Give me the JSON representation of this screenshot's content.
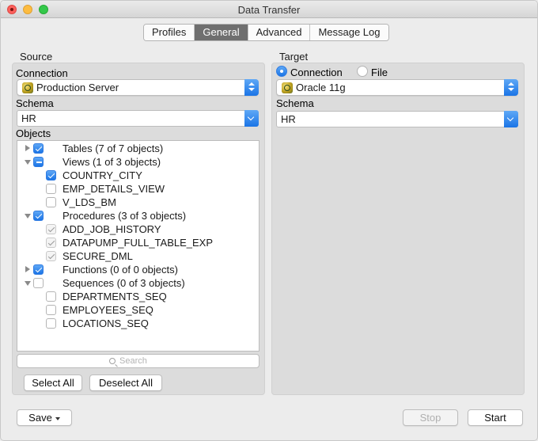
{
  "window": {
    "title": "Data Transfer"
  },
  "tabs": [
    {
      "label": "Profiles",
      "active": false
    },
    {
      "label": "General",
      "active": true
    },
    {
      "label": "Advanced",
      "active": false
    },
    {
      "label": "Message Log",
      "active": false
    }
  ],
  "source": {
    "section_label": "Source",
    "connection_label": "Connection",
    "connection_value": "Production Server",
    "schema_label": "Schema",
    "schema_value": "HR",
    "objects_label": "Objects",
    "tree": [
      {
        "label": "Tables (7 of 7 objects)",
        "level": 0,
        "expander": "collapsed",
        "check": "on"
      },
      {
        "label": "Views (1 of 3 objects)",
        "level": 0,
        "expander": "expanded",
        "check": "mixed"
      },
      {
        "label": "COUNTRY_CITY",
        "level": 1,
        "expander": "none",
        "check": "on"
      },
      {
        "label": "EMP_DETAILS_VIEW",
        "level": 1,
        "expander": "none",
        "check": "off"
      },
      {
        "label": "V_LDS_BM",
        "level": 1,
        "expander": "none",
        "check": "off"
      },
      {
        "label": "Procedures (3 of 3 objects)",
        "level": 0,
        "expander": "expanded",
        "check": "on"
      },
      {
        "label": "ADD_JOB_HISTORY",
        "level": 1,
        "expander": "none",
        "check": "dim"
      },
      {
        "label": "DATAPUMP_FULL_TABLE_EXP",
        "level": 1,
        "expander": "none",
        "check": "dim"
      },
      {
        "label": "SECURE_DML",
        "level": 1,
        "expander": "none",
        "check": "dim"
      },
      {
        "label": "Functions (0 of 0 objects)",
        "level": 0,
        "expander": "collapsed",
        "check": "on"
      },
      {
        "label": "Sequences (0 of 3 objects)",
        "level": 0,
        "expander": "expanded",
        "check": "off"
      },
      {
        "label": "DEPARTMENTS_SEQ",
        "level": 1,
        "expander": "none",
        "check": "off"
      },
      {
        "label": "EMPLOYEES_SEQ",
        "level": 1,
        "expander": "none",
        "check": "off"
      },
      {
        "label": "LOCATIONS_SEQ",
        "level": 1,
        "expander": "none",
        "check": "off"
      }
    ],
    "search_placeholder": "Search",
    "select_all_label": "Select All",
    "deselect_all_label": "Deselect All"
  },
  "target": {
    "section_label": "Target",
    "radio_connection_label": "Connection",
    "radio_file_label": "File",
    "selected_radio": "connection",
    "connection_value": "Oracle 11g",
    "schema_label": "Schema",
    "schema_value": "HR"
  },
  "footer": {
    "save_label": "Save",
    "stop_label": "Stop",
    "start_label": "Start"
  },
  "colors": {
    "accent": "#1a74e6",
    "active_tab": "#6f6f6f",
    "panel": "#dcdcdc"
  }
}
